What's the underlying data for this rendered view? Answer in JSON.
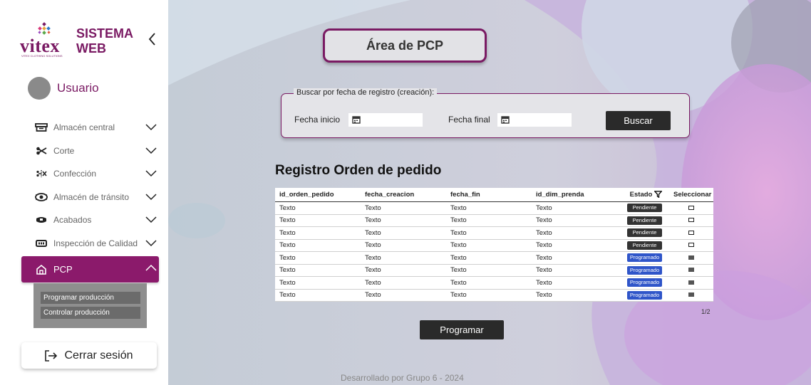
{
  "sidebar": {
    "logo_text": "vitex",
    "logo_sub": "VITEX CLOTHING SOLUTIONS",
    "app_title": "SISTEMA WEB",
    "user_name": "Usuario",
    "items": [
      {
        "label": "Almacén central",
        "icon": "warehouse-icon"
      },
      {
        "label": "Corte",
        "icon": "scissors-icon"
      },
      {
        "label": "Confección",
        "icon": "sewing-icon"
      },
      {
        "label": "Almacén de tránsito",
        "icon": "transit-icon"
      },
      {
        "label": "Acabados",
        "icon": "finishing-icon"
      },
      {
        "label": "Inspección de Calidad",
        "icon": "inspection-icon"
      },
      {
        "label": "PCP",
        "icon": "home-icon",
        "active": true
      }
    ],
    "submenu": [
      "Programar producción",
      "Controlar producción"
    ],
    "logout_label": "Cerrar sesión"
  },
  "main": {
    "page_title": "Área de PCP",
    "search": {
      "legend": "Buscar por fecha de registro (creación):",
      "start_label": "Fecha inicio",
      "end_label": "Fecha final",
      "start_value": "",
      "end_value": "",
      "button": "Buscar"
    },
    "section_title": "Registro Orden de pedido",
    "table": {
      "columns": [
        "id_orden_pedido",
        "fecha_creacion",
        "fecha_fin",
        "id_dim_prenda",
        "Estado",
        "Seleccionar"
      ],
      "rows": [
        {
          "c": [
            "Texto",
            "Texto",
            "Texto",
            "Texto"
          ],
          "estado": "Pendiente",
          "sel": false
        },
        {
          "c": [
            "Texto",
            "Texto",
            "Texto",
            "Texto"
          ],
          "estado": "Pendiente",
          "sel": false
        },
        {
          "c": [
            "Texto",
            "Texto",
            "Texto",
            "Texto"
          ],
          "estado": "Pendiente",
          "sel": false
        },
        {
          "c": [
            "Texto",
            "Texto",
            "Texto",
            "Texto"
          ],
          "estado": "Pendiente",
          "sel": false
        },
        {
          "c": [
            "Texto",
            "Texto",
            "Texto",
            "Texto"
          ],
          "estado": "Programado",
          "sel": true
        },
        {
          "c": [
            "Texto",
            "Texto",
            "Texto",
            "Texto"
          ],
          "estado": "Programado",
          "sel": true
        },
        {
          "c": [
            "Texto",
            "Texto",
            "Texto",
            "Texto"
          ],
          "estado": "Programado",
          "sel": true
        },
        {
          "c": [
            "Texto",
            "Texto",
            "Texto",
            "Texto"
          ],
          "estado": "Programado",
          "sel": true
        }
      ]
    },
    "pager": "1/2",
    "program_button": "Programar",
    "footer": "Desarrollado por Grupo 6 - 2024"
  },
  "colors": {
    "brand": "#7a1a63",
    "active_nav": "#8b1a6b",
    "pending": "#333333",
    "scheduled": "#2f55c9"
  }
}
